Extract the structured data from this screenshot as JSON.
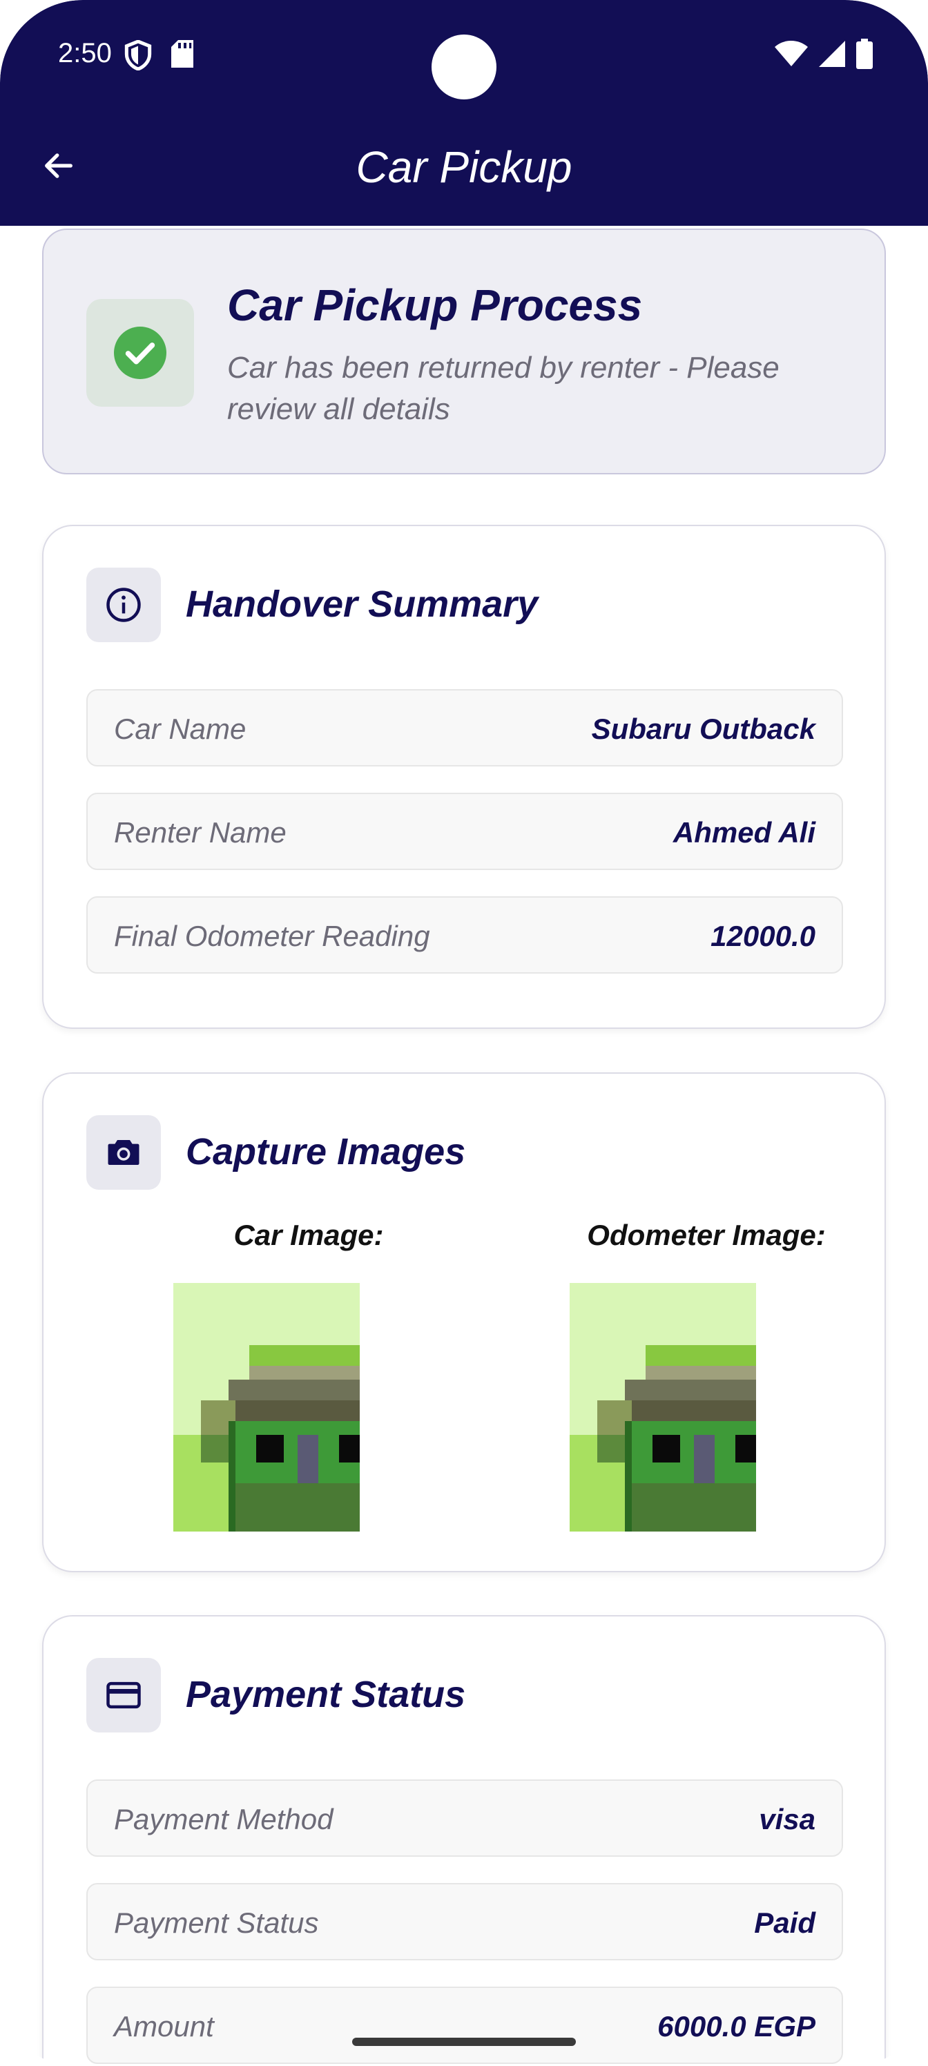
{
  "status_bar": {
    "time": "2:50"
  },
  "header": {
    "title": "Car Pickup"
  },
  "banner": {
    "title": "Car Pickup Process",
    "subtitle": "Car has been returned by renter - Please review all details",
    "icon": "check-circle-icon"
  },
  "handover": {
    "title": "Handover Summary",
    "icon": "info-icon",
    "rows": [
      {
        "label": "Car Name",
        "value": "Subaru Outback"
      },
      {
        "label": "Renter Name",
        "value": "Ahmed Ali"
      },
      {
        "label": "Final Odometer Reading",
        "value": "12000.0"
      }
    ]
  },
  "images": {
    "title": "Capture Images",
    "icon": "camera-icon",
    "car_label": "Car Image:",
    "odometer_label": "Odometer Image:"
  },
  "payment": {
    "title": "Payment Status",
    "icon": "credit-card-icon",
    "rows": [
      {
        "label": "Payment Method",
        "value": "visa"
      },
      {
        "label": "Payment Status",
        "value": "Paid"
      },
      {
        "label": "Amount",
        "value": "6000.0 EGP"
      }
    ]
  },
  "colors": {
    "primary": "#120e55",
    "success": "#4caf50"
  }
}
